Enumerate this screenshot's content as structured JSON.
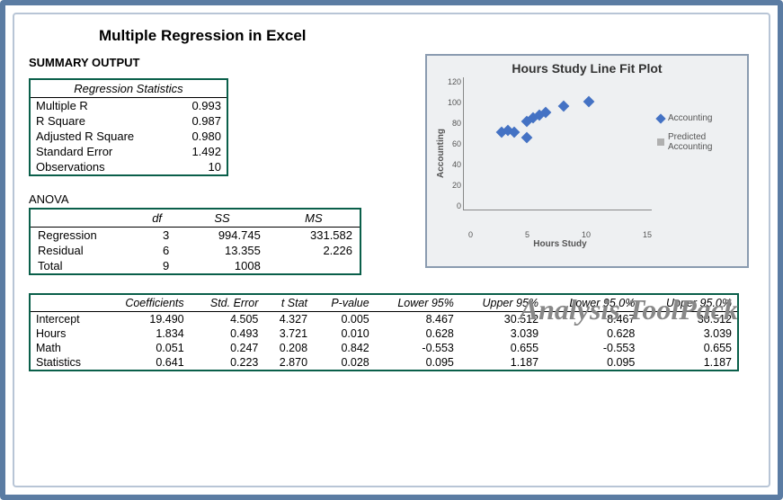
{
  "title": "Multiple Regression in Excel",
  "summary_label": "SUMMARY OUTPUT",
  "reg_stats": {
    "header": "Regression Statistics",
    "rows": [
      {
        "label": "Multiple R",
        "value": "0.993"
      },
      {
        "label": "R Square",
        "value": "0.987"
      },
      {
        "label": "Adjusted R Square",
        "value": "0.980"
      },
      {
        "label": "Standard Error",
        "value": "1.492"
      },
      {
        "label": "Observations",
        "value": "10"
      }
    ]
  },
  "anova": {
    "label": "ANOVA",
    "headers": {
      "df": "df",
      "ss": "SS",
      "ms": "MS"
    },
    "rows": [
      {
        "label": "Regression",
        "df": "3",
        "ss": "994.745",
        "ms": "331.582"
      },
      {
        "label": "Residual",
        "df": "6",
        "ss": "13.355",
        "ms": "2.226"
      },
      {
        "label": "Total",
        "df": "9",
        "ss": "1008",
        "ms": ""
      }
    ]
  },
  "coef": {
    "headers": {
      "c0": "",
      "c1": "Coefficients",
      "c2": "Std. Error",
      "c3": "t Stat",
      "c4": "P-value",
      "c5": "Lower 95%",
      "c6": "Upper 95%",
      "c7": "Lower 95.0%",
      "c8": "Upper 95.0%"
    },
    "rows": [
      {
        "label": "Intercept",
        "coef": "19.490",
        "se": "4.505",
        "t": "4.327",
        "p": "0.005",
        "l95": "8.467",
        "u95": "30.512",
        "l950": "8.467",
        "u950": "30.512"
      },
      {
        "label": "Hours",
        "coef": "1.834",
        "se": "0.493",
        "t": "3.721",
        "p": "0.010",
        "l95": "0.628",
        "u95": "3.039",
        "l950": "0.628",
        "u950": "3.039"
      },
      {
        "label": "Math",
        "coef": "0.051",
        "se": "0.247",
        "t": "0.208",
        "p": "0.842",
        "l95": "-0.553",
        "u95": "0.655",
        "l950": "-0.553",
        "u950": "0.655"
      },
      {
        "label": "Statistics",
        "coef": "0.641",
        "se": "0.223",
        "t": "2.870",
        "p": "0.028",
        "l95": "0.095",
        "u95": "1.187",
        "l950": "0.095",
        "u950": "1.187"
      }
    ]
  },
  "chart_data": {
    "type": "scatter",
    "title": "Hours Study Line Fit  Plot",
    "xlabel": "Hours Study",
    "ylabel": "Accounting",
    "xlim": [
      0,
      15
    ],
    "ylim": [
      0,
      120
    ],
    "xticks": [
      0,
      5,
      10,
      15
    ],
    "yticks": [
      0,
      20,
      40,
      60,
      80,
      100,
      120
    ],
    "series": [
      {
        "name": "Accounting",
        "marker": "diamond",
        "color": "#4472c4",
        "points": [
          {
            "x": 3,
            "y": 70
          },
          {
            "x": 3.5,
            "y": 72
          },
          {
            "x": 4,
            "y": 70
          },
          {
            "x": 5,
            "y": 65
          },
          {
            "x": 5,
            "y": 80
          },
          {
            "x": 5.5,
            "y": 83
          },
          {
            "x": 6,
            "y": 86
          },
          {
            "x": 6.5,
            "y": 88
          },
          {
            "x": 8,
            "y": 94
          },
          {
            "x": 10,
            "y": 98
          }
        ]
      },
      {
        "name": "Predicted Accounting",
        "marker": "square",
        "color": "#b0b0b0",
        "points": []
      }
    ]
  },
  "toolpack_label": "Analysis ToolPack"
}
